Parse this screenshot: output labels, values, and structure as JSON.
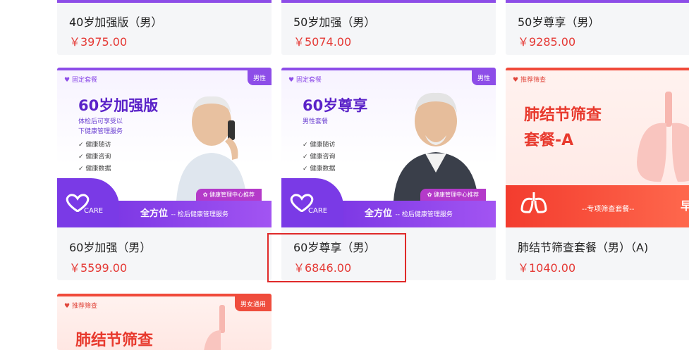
{
  "cards": [
    {
      "title": "40岁加强版（男）",
      "price": "￥3975.00"
    },
    {
      "title": "50岁加强（男）",
      "price": "￥5074.00"
    },
    {
      "title": "50岁尊享（男）",
      "price": "￥9285.00"
    },
    {
      "title": "60岁加强（男）",
      "price": "￥5599.00",
      "banner": {
        "tag_left": "固定套餐",
        "tag_right": "男性",
        "headline": "60岁加强版",
        "sub": [
          "体检后可享受以",
          "下健康管理服务"
        ],
        "list": [
          "健康随访",
          "健康咨询",
          "健康数据"
        ],
        "recommend": "健康管理中心推荐",
        "footer_main": "全方位",
        "footer_sub": "-- 检后健康管理服务",
        "logo_text": "CARE"
      }
    },
    {
      "title": "60岁尊享（男）",
      "price": "￥6846.00",
      "banner": {
        "tag_left": "固定套餐",
        "tag_right": "男性",
        "headline": "60岁尊享",
        "sub": [
          "男性套餐"
        ],
        "list": [
          "健康随访",
          "健康咨询",
          "健康数据"
        ],
        "recommend": "健康管理中心推荐",
        "footer_main": "全方位",
        "footer_sub": "-- 检后健康管理服务",
        "logo_text": "CARE"
      }
    },
    {
      "title": "肺结节筛查套餐（男）（A)",
      "price": "￥1040.00",
      "banner": {
        "tag_left": "推荐筛查",
        "headline_lines": [
          "肺结节筛查",
          "套餐-A"
        ],
        "footer_sub": "--专项筛查套餐--",
        "footer_right": "早发"
      }
    },
    {
      "banner": {
        "tag_left": "推荐筛查",
        "tag_right": "男女通用",
        "headline_partial": "肺结节筛查"
      }
    }
  ]
}
